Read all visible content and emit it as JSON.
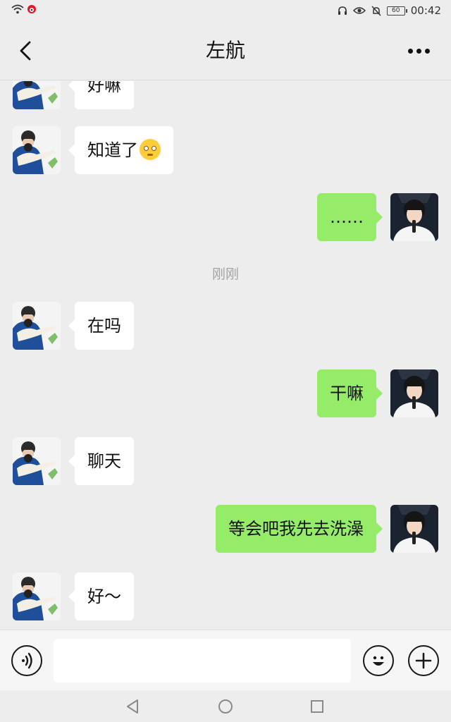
{
  "status_bar": {
    "time": "00:42",
    "battery": "60",
    "icons": [
      "wifi-icon",
      "weibo-icon",
      "headphones-icon",
      "eye-icon",
      "mute-icon",
      "battery-icon"
    ]
  },
  "header": {
    "title": "左航",
    "back_icon": "chevron-left-icon",
    "more_icon": "more-icon"
  },
  "messages": [
    {
      "side": "in",
      "text": "好嘛"
    },
    {
      "side": "in",
      "text": "知道了",
      "emoji": "pleading-face-emoji"
    },
    {
      "side": "out",
      "text": "……"
    },
    {
      "side": "time",
      "text": "刚刚"
    },
    {
      "side": "in",
      "text": "在吗"
    },
    {
      "side": "out",
      "text": "干嘛"
    },
    {
      "side": "in",
      "text": "聊天"
    },
    {
      "side": "out",
      "text": "等会吧我先去洗澡"
    },
    {
      "side": "in",
      "text": "好～"
    }
  ],
  "input_bar": {
    "voice_icon": "voice-icon",
    "emoji_icon": "emoji-icon",
    "plus_icon": "plus-icon",
    "value": ""
  },
  "nav_bar": {
    "icons": [
      "nav-back-icon",
      "nav-home-icon",
      "nav-recents-icon"
    ]
  },
  "colors": {
    "background": "#ededed",
    "incoming_bubble": "#ffffff",
    "outgoing_bubble": "#95ec69",
    "timestamp": "#a3a3a3"
  }
}
